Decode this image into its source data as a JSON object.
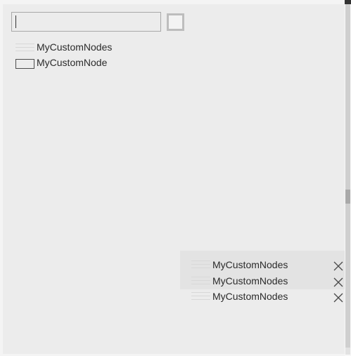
{
  "search": {
    "value": "",
    "placeholder": ""
  },
  "tree": {
    "items": [
      {
        "label": "MyCustomNodes",
        "icon": "lines-icon"
      },
      {
        "label": "MyCustomNode",
        "icon": "node-box-icon"
      }
    ]
  },
  "panel": {
    "items": [
      {
        "label": "MyCustomNodes",
        "icon": "lines-icon",
        "action_icon": "close-icon"
      },
      {
        "label": "MyCustomNodes",
        "icon": "lines-icon",
        "action_icon": "close-icon"
      },
      {
        "label": "MyCustomNodes",
        "icon": "lines-icon",
        "action_icon": "close-icon"
      }
    ]
  },
  "colors": {
    "background": "#ececec",
    "panel_background": "#e3e3e3",
    "text": "#2b2b2b",
    "border": "#a8a8a8"
  }
}
